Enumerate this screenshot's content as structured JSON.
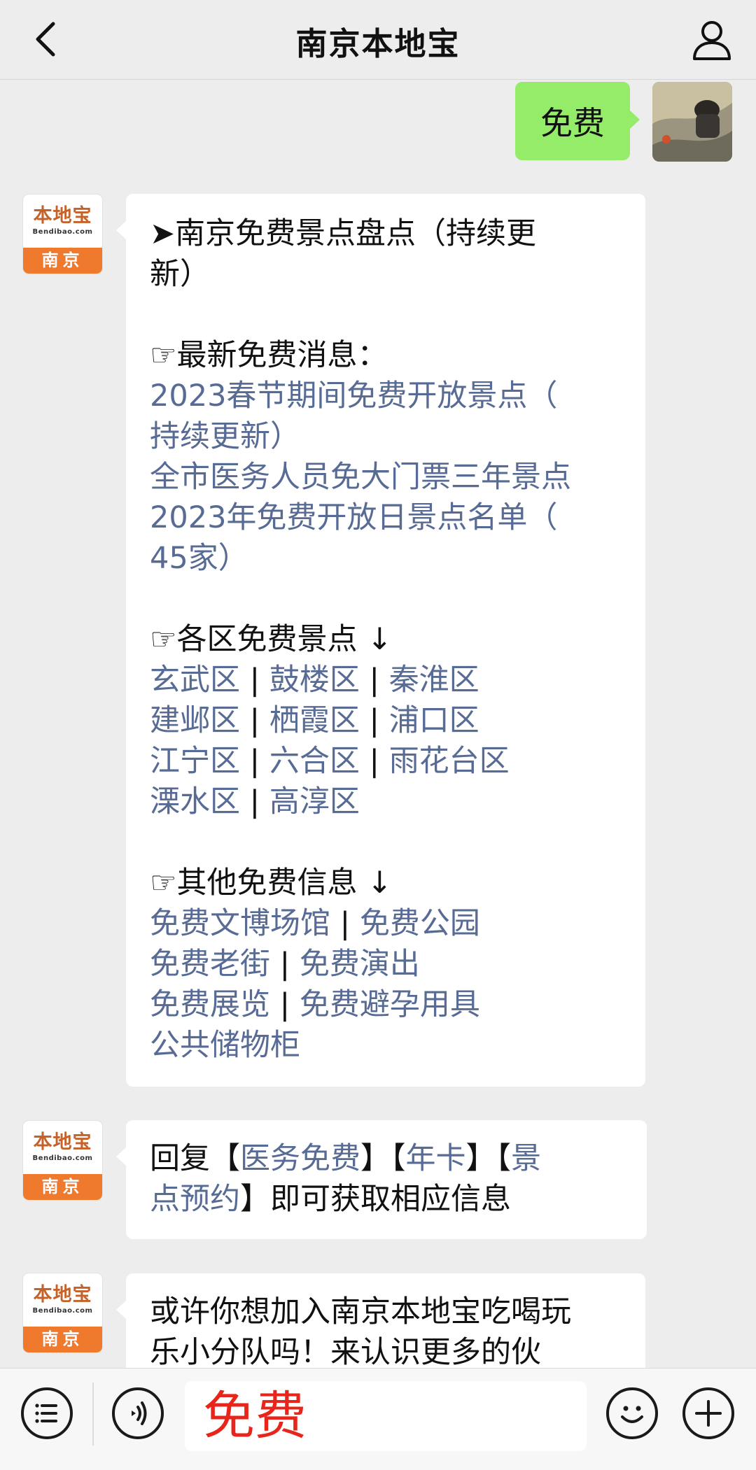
{
  "header": {
    "title": "南京本地宝"
  },
  "outgoing": {
    "text": "免费"
  },
  "bot_avatar": {
    "logo_cn": "本地宝",
    "logo_en": "Bendibao.com",
    "city": "南京"
  },
  "message1": {
    "title_line1": "➤南京免费景点盘点（持续更",
    "title_line2": "新）",
    "section1_heading": "☞最新免费消息：",
    "news_links": [
      "2023春节期间免费开放景点（",
      "持续更新）",
      "全市医务人员免大门票三年景点",
      "2023年免费开放日景点名单（",
      "45家）"
    ],
    "section2_heading": "☞各区免费景点 ↓",
    "districts": [
      [
        "玄武区",
        "鼓楼区",
        "秦淮区"
      ],
      [
        "建邺区",
        "栖霞区",
        "浦口区"
      ],
      [
        "江宁区",
        "六合区",
        "雨花台区"
      ],
      [
        "溧水区",
        "高淳区"
      ]
    ],
    "separator": "|",
    "section3_heading": "☞其他免费信息 ↓",
    "other_links": [
      [
        "免费文博场馆",
        "免费公园"
      ],
      [
        "免费老街",
        "免费演出"
      ],
      [
        "免费展览",
        "免费避孕用具"
      ],
      [
        "公共储物柜"
      ]
    ]
  },
  "message2": {
    "prefix": "回复【",
    "link1": "医务免费",
    "mid1": "】【",
    "link2": "年卡",
    "mid2": "】【",
    "link3a": "景",
    "link3b": "点预约",
    "suffix": "】即可获取相应信息"
  },
  "message3": {
    "line1": "或许你想加入南京本地宝吃喝玩",
    "line2": "乐小分队吗！来认识更多的伙"
  },
  "input": {
    "value": "免费"
  },
  "icons": [
    "back-icon",
    "profile-icon",
    "menu-icon",
    "voice-icon",
    "emoji-icon",
    "plus-icon"
  ]
}
